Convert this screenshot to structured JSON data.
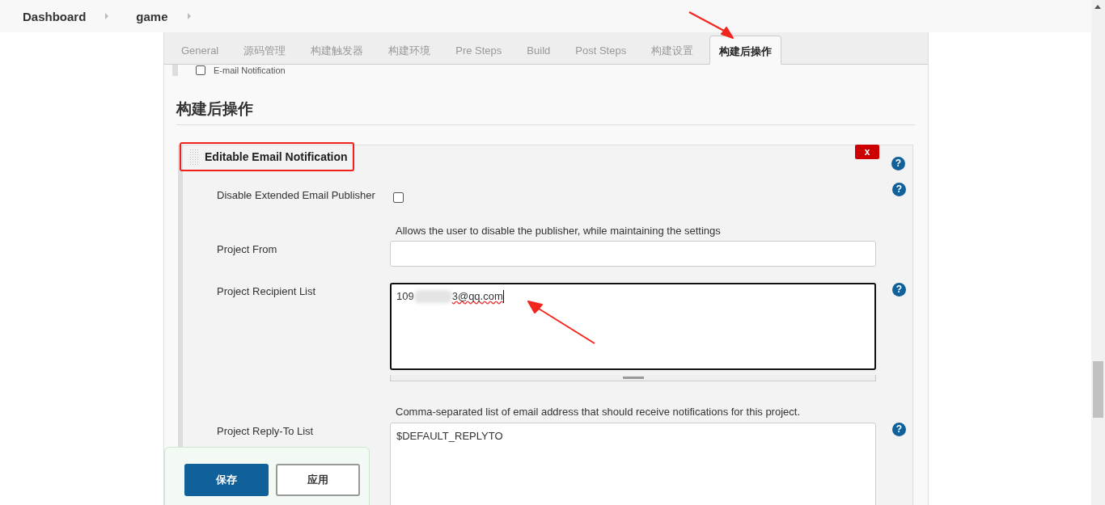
{
  "breadcrumbs": [
    "Dashboard",
    "game"
  ],
  "tabs": [
    {
      "label": "General",
      "selected": false
    },
    {
      "label": "源码管理",
      "selected": false
    },
    {
      "label": "构建触发器",
      "selected": false
    },
    {
      "label": "构建环境",
      "selected": false
    },
    {
      "label": "Pre Steps",
      "selected": false
    },
    {
      "label": "Build",
      "selected": false
    },
    {
      "label": "Post Steps",
      "selected": false
    },
    {
      "label": "构建设置",
      "selected": false
    },
    {
      "label": "构建后操作",
      "selected": true
    }
  ],
  "partial_item": {
    "label": "E-mail Notification",
    "checked": false
  },
  "section_title": "构建后操作",
  "publisher": {
    "title": "Editable Email Notification",
    "delete_button": "x",
    "help": "?"
  },
  "fields": [
    {
      "kind": "checkbox",
      "label": "Disable Extended Email Publisher",
      "checked": false,
      "help": "?",
      "description": "Allows the user to disable the publisher, while maintaining the settings"
    },
    {
      "kind": "text",
      "label": "Project From"
    },
    {
      "kind": "redacted",
      "label": "Project Recipient List",
      "value_prefix": "109",
      "value_suffix": "3@qq.com",
      "help": "?",
      "description": "Comma-separated list of email address that should receive notifications for this project."
    },
    {
      "kind": "textarea",
      "label": "Project Reply-To List",
      "value": "$DEFAULT_REPLYTO",
      "help": "?"
    }
  ],
  "buttons": [
    {
      "label": "保存",
      "kind": "primary"
    },
    {
      "label": "应用",
      "kind": "secondary"
    }
  ]
}
